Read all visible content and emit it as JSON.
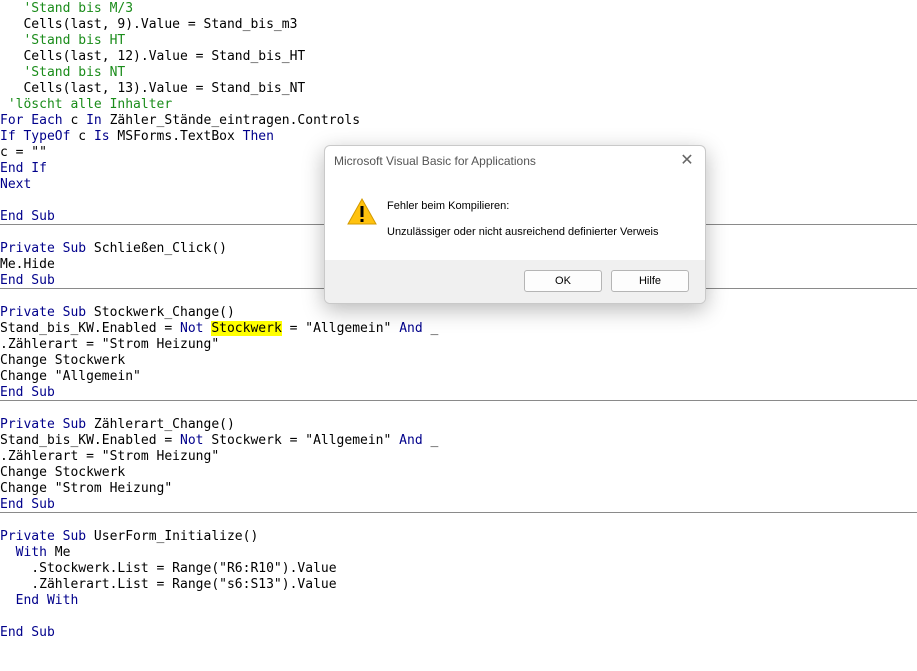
{
  "code_lines": [
    "   'Stand bis M/3",
    "   Cells(last, 9).Value = Stand_bis_m3",
    "   'Stand bis HT",
    "   Cells(last, 12).Value = Stand_bis_HT",
    "   'Stand bis NT",
    "   Cells(last, 13).Value = Stand_bis_NT",
    " 'löscht alle Inhalter",
    "For Each c In Zähler_Stände_eintragen.Controls",
    "If TypeOf c Is MSForms.TextBox Then",
    "c = \"\"",
    "End If",
    "Next",
    "",
    "End Sub",
    "",
    "Private Sub Schließen_Click()",
    "Me.Hide",
    "End Sub",
    "",
    "Private Sub Stockwerk_Change()",
    "Stand_bis_KW.Enabled = Not Stockwerk = \"Allgemein\" And _",
    ".Zählerart = \"Strom Heizung\"",
    "Change Stockwerk",
    "Change \"Allgemein\"",
    "End Sub",
    "",
    "Private Sub Zählerart_Change()",
    "Stand_bis_KW.Enabled = Not Stockwerk = \"Allgemein\" And _",
    ".Zählerart = \"Strom Heizung\"",
    "Change Stockwerk",
    "Change \"Strom Heizung\"",
    "End Sub",
    "",
    "Private Sub UserForm_Initialize()",
    "  With Me",
    "    .Stockwerk.List = Range(\"R6:R10\").Value",
    "    .Zählerart.List = Range(\"s6:S13\").Value",
    "  End With",
    "",
    "End Sub"
  ],
  "comment_line_indexes": [
    0,
    2,
    4,
    6
  ],
  "procedure_separator_after_lines": [
    13,
    17,
    24,
    31
  ],
  "highlighted_word": {
    "line_index": 20,
    "text": "Stockwerk"
  },
  "keywords": [
    "Private Sub",
    "End Sub",
    "For Each",
    "End If",
    "If",
    "In",
    "TypeOf",
    "Is",
    "Then",
    "Next",
    "Not",
    "And",
    "With",
    "End With"
  ],
  "colors": {
    "keyword": "#00008b",
    "comment": "#1a8c1a",
    "highlight": "#ffff00"
  },
  "dialog": {
    "title": "Microsoft Visual Basic for Applications",
    "icon": "warning-icon",
    "heading": "Fehler beim Kompilieren:",
    "message": "Unzulässiger oder nicht ausreichend definierter Verweis",
    "ok_label": "OK",
    "help_label": "Hilfe"
  }
}
